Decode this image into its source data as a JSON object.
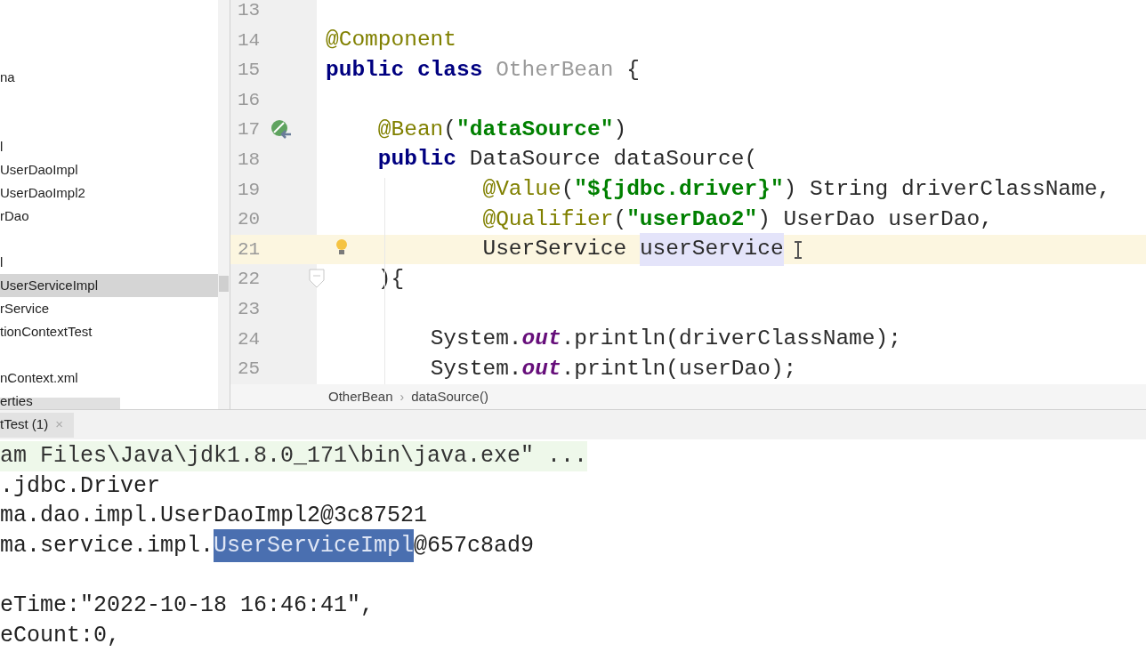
{
  "project_tree": {
    "items": [
      {
        "label": "na",
        "selected": false
      },
      {
        "label": "l",
        "selected": false
      },
      {
        "label": "UserDaoImpl",
        "selected": false
      },
      {
        "label": "UserDaoImpl2",
        "selected": false
      },
      {
        "label": "rDao",
        "selected": false
      },
      {
        "label": "l",
        "selected": false
      },
      {
        "label": "UserServiceImpl",
        "selected": true
      },
      {
        "label": "rService",
        "selected": false
      },
      {
        "label": "tionContextTest",
        "selected": false
      },
      {
        "label": "nContext.xml",
        "selected": false
      },
      {
        "label": "erties",
        "selected": false
      }
    ]
  },
  "editor": {
    "lines": [
      {
        "number": "13",
        "current": false,
        "kind": "plain"
      },
      {
        "number": "14",
        "current": false,
        "kind": "plain",
        "tokens": [
          {
            "kind": "annotation",
            "text": "@Component"
          }
        ]
      },
      {
        "number": "15",
        "current": false,
        "kind": "plain",
        "tokens": [
          {
            "kind": "keyword",
            "text": "public class "
          },
          {
            "kind": "unused",
            "text": "OtherBean"
          },
          {
            "kind": "plain",
            "text": " {"
          }
        ]
      },
      {
        "number": "16",
        "current": false,
        "kind": "plain"
      },
      {
        "number": "17",
        "current": false,
        "kind": "bean",
        "tokens": [
          {
            "kind": "annotation",
            "text": "    @Bean"
          },
          {
            "kind": "plain",
            "text": "("
          },
          {
            "kind": "string",
            "text": "\"dataSource\""
          },
          {
            "kind": "plain",
            "text": ")"
          }
        ]
      },
      {
        "number": "18",
        "current": false,
        "kind": "plain",
        "tokens": [
          {
            "kind": "keyword",
            "text": "    public "
          },
          {
            "kind": "plain",
            "text": "DataSource dataSource("
          }
        ]
      },
      {
        "number": "19",
        "current": false,
        "kind": "plain",
        "tokens": [
          {
            "kind": "annotation",
            "text": "            @Value"
          },
          {
            "kind": "plain",
            "text": "("
          },
          {
            "kind": "string",
            "text": "\"${jdbc.driver}\""
          },
          {
            "kind": "plain",
            "text": ") String driverClassName,"
          }
        ]
      },
      {
        "number": "20",
        "current": false,
        "kind": "plain",
        "tokens": [
          {
            "kind": "annotation",
            "text": "            @Qualifier"
          },
          {
            "kind": "plain",
            "text": "("
          },
          {
            "kind": "string",
            "text": "\"userDao2\""
          },
          {
            "kind": "plain",
            "text": ") UserDao userDao,"
          }
        ]
      },
      {
        "number": "21",
        "current": true,
        "kind": "bulb",
        "tokens": [
          {
            "kind": "plain",
            "text": "            UserService "
          },
          {
            "kind": "plain",
            "text": "userService",
            "highlighted": true
          }
        ]
      },
      {
        "number": "22",
        "current": false,
        "kind": "fold",
        "tokens": [
          {
            "kind": "plain",
            "text": "    ){"
          }
        ]
      },
      {
        "number": "23",
        "current": false,
        "kind": "plain"
      },
      {
        "number": "24",
        "current": false,
        "kind": "plain",
        "tokens": [
          {
            "kind": "plain",
            "text": "        System."
          },
          {
            "kind": "field",
            "text": "out"
          },
          {
            "kind": "plain",
            "text": ".println(driverClassName);"
          }
        ]
      },
      {
        "number": "25",
        "current": false,
        "kind": "plain",
        "tokens": [
          {
            "kind": "plain",
            "text": "        System."
          },
          {
            "kind": "field",
            "text": "out"
          },
          {
            "kind": "plain",
            "text": ".println(userDao);"
          }
        ]
      }
    ],
    "breadcrumbs": [
      "OtherBean",
      "dataSource()"
    ],
    "breadcrumb_separator": "›"
  },
  "run_panel": {
    "tabs": [
      {
        "label": "tTest (1)",
        "selected": true,
        "close": "×"
      }
    ],
    "lines": [
      {
        "kind": "command",
        "parts": [
          {
            "text": "am Files\\Java\\jdk1.8.0_171\\bin\\java.exe\" ..."
          }
        ]
      },
      {
        "kind": "output",
        "parts": [
          {
            "text": ".jdbc.Driver"
          }
        ]
      },
      {
        "kind": "output",
        "parts": [
          {
            "text": "ma.dao.impl.UserDaoImpl2@3c87521"
          }
        ]
      },
      {
        "kind": "output",
        "parts": [
          {
            "text": "ma.service.impl."
          },
          {
            "text": "UserServiceImpl",
            "selected": true
          },
          {
            "text": "@657c8ad9"
          }
        ]
      },
      {
        "kind": "blank"
      },
      {
        "kind": "output",
        "parts": [
          {
            "text": "eTime:\"2022-10-18 16:46:41\","
          }
        ]
      },
      {
        "kind": "output",
        "parts": [
          {
            "text": "eCount:0,"
          }
        ]
      }
    ]
  }
}
